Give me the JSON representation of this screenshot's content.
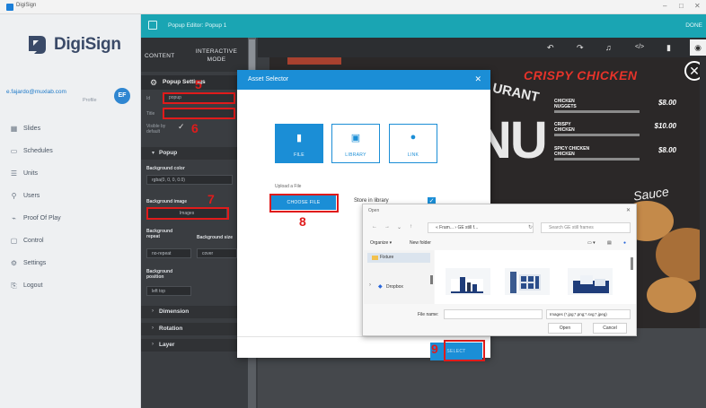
{
  "window": {
    "title": "DigiSign",
    "min": "–",
    "max": "□",
    "close": "✕"
  },
  "brand": {
    "name": "DigiSign"
  },
  "user": {
    "email": "e.fajardo@muxlab.com",
    "profile": "Profile",
    "initials": "EF"
  },
  "nav": [
    {
      "label": "Slides",
      "icon": "▦"
    },
    {
      "label": "Schedules",
      "icon": "▭"
    },
    {
      "label": "Units",
      "icon": "☰"
    },
    {
      "label": "Users",
      "icon": "⚲"
    },
    {
      "label": "Proof Of Play",
      "icon": "⌁"
    },
    {
      "label": "Control",
      "icon": "▢"
    },
    {
      "label": "Settings",
      "icon": "⚙"
    },
    {
      "label": "Logout",
      "icon": "⎘"
    }
  ],
  "topbar": {
    "title": "Popup Editor: Popup 1",
    "done": "DONE"
  },
  "tabs": {
    "content": "CONTENT",
    "interactive": "INTERACTIVE MODE"
  },
  "settings": {
    "title": "Popup Settings",
    "id_label": "Id",
    "id_value": "popup",
    "title_label": "Title",
    "title_value": "",
    "visible_label": "Visible by default",
    "visible_check": "✓"
  },
  "sections": {
    "popup": "Popup",
    "dimension": "Dimension",
    "rotation": "Rotation",
    "layer": "Layer"
  },
  "popup_props": {
    "bg_color_label": "Background color",
    "bg_color_value": "rgba(0, 0, 0, 0.0)",
    "bg_image_label": "Background image",
    "bg_image_value": "Images",
    "bg_repeat_label": "Background repeat",
    "bg_repeat_value": "no-repeat",
    "bg_size_label": "Background size",
    "bg_size_value": "cover",
    "bg_position_label": "Background position",
    "bg_position_value": "left top"
  },
  "annotations": {
    "n5": "5",
    "n6": "6",
    "n7": "7",
    "n8": "8",
    "n9": "9"
  },
  "toolbar_icons": [
    "undo-icon",
    "redo-icon",
    "music-icon",
    "code-icon",
    "phone-icon",
    "eye-icon"
  ],
  "canvas": {
    "menu_title": "CRISPY CHICKEN",
    "rant": "URANT",
    "menu_big": "NU",
    "sauce": "Sauce",
    "items": [
      {
        "name": "CHICKEN NUGGETS",
        "price": "$8.00"
      },
      {
        "name": "CRISPY CHICKEN",
        "price": "$10.00"
      },
      {
        "name": "SPICY CHICKEN CHICKEN",
        "price": "$8.00"
      }
    ]
  },
  "modal": {
    "title": "Asset Selector",
    "close": "✕",
    "sources": [
      {
        "label": "FILE",
        "icon": "▮"
      },
      {
        "label": "LIBRARY",
        "icon": "▣"
      },
      {
        "label": "LINK",
        "icon": "●"
      }
    ],
    "upload_label": "Upload a File",
    "choose_file": "CHOOSE FILE",
    "store_label": "Store in library",
    "select": "SELECT"
  },
  "file_dialog": {
    "title": "Open",
    "close": "✕",
    "path": "« Fram... › GE still f...",
    "search": "Search GE still frames",
    "organize": "Organize ▾",
    "new_folder": "New folder",
    "favorite": "Fixture",
    "dropbox": "Dropbox",
    "file_name_label": "File name:",
    "file_name_value": "",
    "file_type": "Images (*.jpg;*.png;*.svg;*.jpeg)",
    "open": "Open",
    "cancel": "Cancel"
  }
}
